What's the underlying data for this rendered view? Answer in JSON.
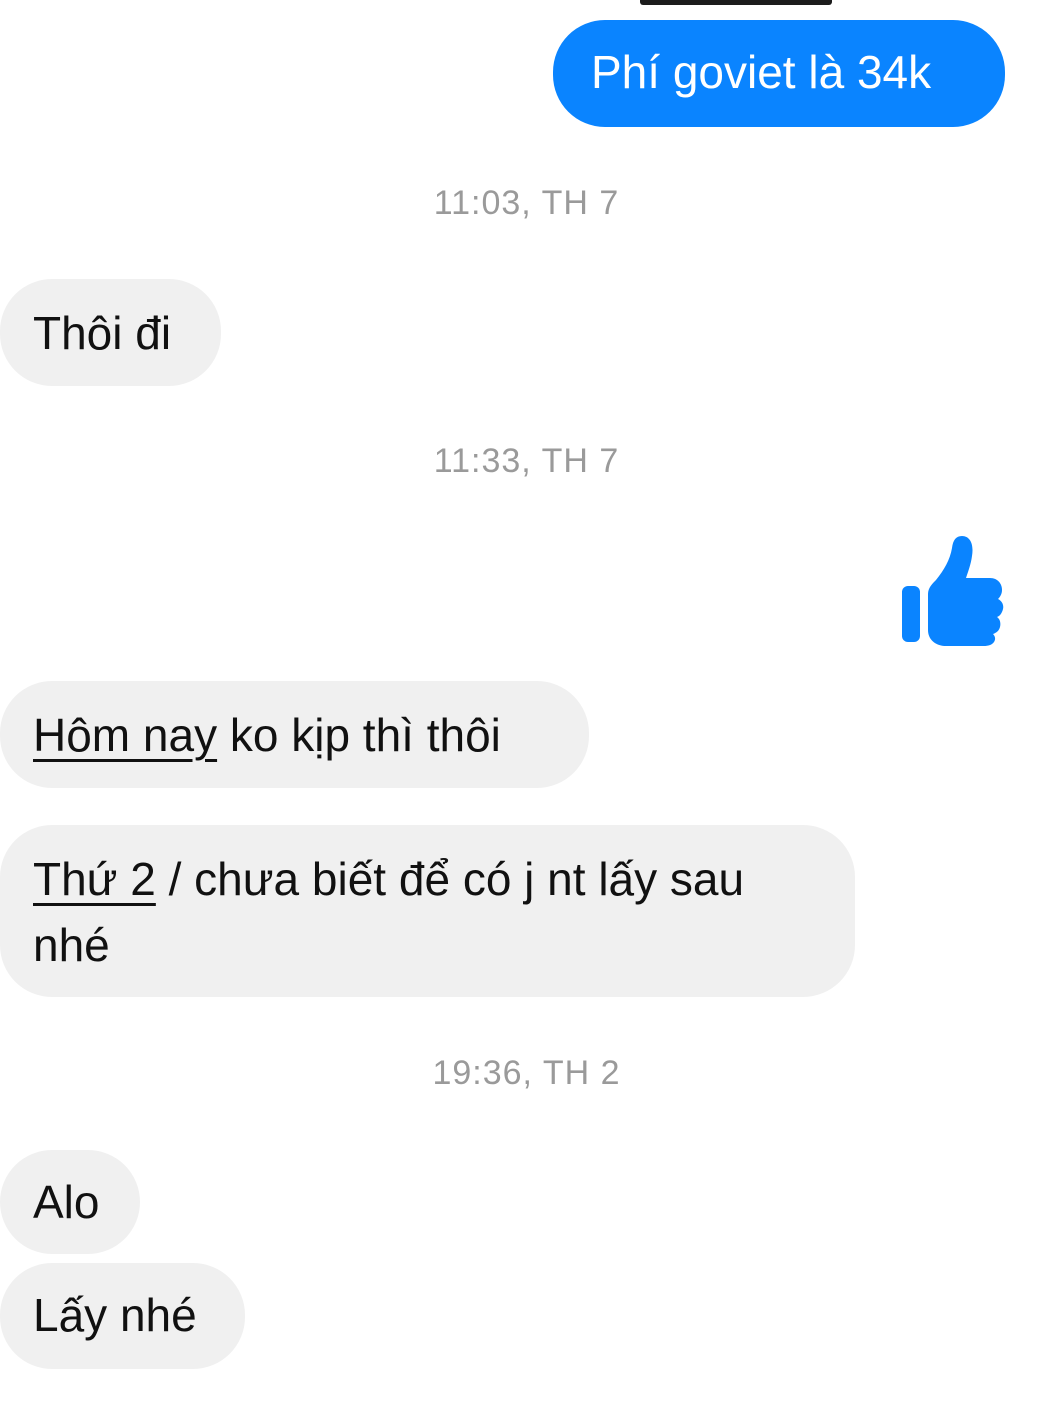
{
  "conversation": {
    "messages": [
      {
        "sender": "me",
        "text": "Phí goviet là 34k"
      },
      {
        "sender": "other",
        "text": "Thôi đi"
      },
      {
        "sender": "me",
        "reaction": "thumbs-up-icon"
      },
      {
        "sender": "other",
        "text_link": "Hôm nay",
        "text_rest": " ko kịp thì thôi"
      },
      {
        "sender": "other",
        "text_link": "Thứ 2",
        "text_rest": " / chưa biết để có j nt lấy sau nhé"
      },
      {
        "sender": "other",
        "text": "Alo"
      },
      {
        "sender": "other",
        "text": "Lấy nhé"
      }
    ],
    "timestamps": [
      "11:03, TH 7",
      "11:33, TH 7",
      "19:36, TH 2"
    ]
  },
  "colors": {
    "sent_bubble": "#0a84ff",
    "received_bubble": "#f0f0f0",
    "timestamp_text": "#9a9a9a",
    "like_icon": "#0a84ff"
  }
}
